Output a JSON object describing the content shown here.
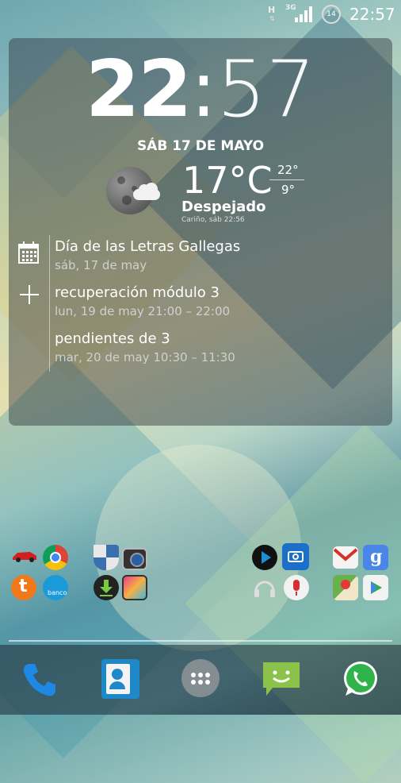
{
  "status_bar": {
    "network_h": "H",
    "network_3g": "3G",
    "battery_level": "14",
    "time": "22:57"
  },
  "clock": {
    "hours": "22",
    "separator": ":",
    "minutes": "57"
  },
  "date": "SÁB 17 DE MAYO",
  "weather": {
    "temp": "17°C",
    "high": "22°",
    "low": "9°",
    "condition": "Despejado",
    "location_time": "Cariño, sáb 22:56",
    "icon": "moon-cloud-icon"
  },
  "events": [
    {
      "title": "Día de las Letras Gallegas",
      "time": "sáb, 17 de may"
    },
    {
      "title": "recuperación módulo 3",
      "time": "lun, 19 de may 21:00 – 22:00"
    },
    {
      "title": "pendientes de 3",
      "time": "mar, 20 de may 10:30 – 11:30"
    }
  ],
  "folders": [
    {
      "name": "folder-1",
      "icons": [
        "car-icon",
        "chrome-icon",
        "tuenti-icon",
        "banco-icon"
      ]
    },
    {
      "name": "folder-2",
      "icons": [
        "shield-icon",
        "camera-icon",
        "download-icon",
        "gallery-icon"
      ]
    },
    {
      "name": "folder-3",
      "icons": [
        "play-icon",
        "camera-app-icon",
        "headphones-icon",
        "voice-icon"
      ]
    },
    {
      "name": "folder-4",
      "icons": [
        "gmail-icon",
        "google-icon",
        "maps-icon",
        "play-store-icon"
      ]
    }
  ],
  "banco_label": "banco",
  "dock": [
    "phone-icon",
    "contacts-icon",
    "apps-icon",
    "messaging-icon",
    "whatsapp-icon"
  ],
  "colors": {
    "widget_bg": "#2d323c",
    "whatsapp": "#2fb34a",
    "messaging": "#8bc34a"
  }
}
